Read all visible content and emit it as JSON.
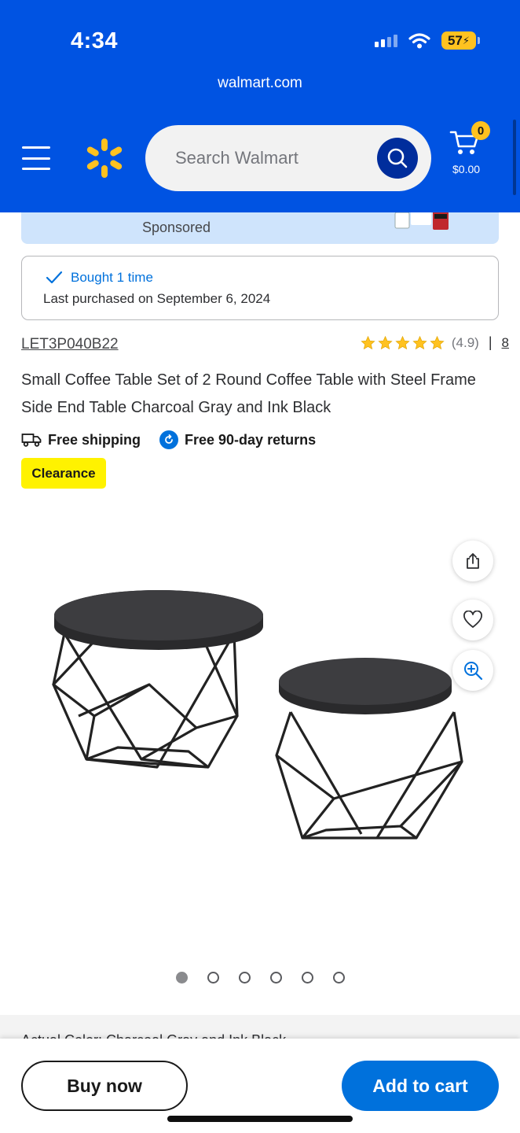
{
  "status_bar": {
    "time": "4:34",
    "battery": "57"
  },
  "browser": {
    "url": "walmart.com"
  },
  "header": {
    "search_placeholder": "Search Walmart",
    "cart_count": "0",
    "cart_total": "$0.00"
  },
  "banner": {
    "sponsored_label": "Sponsored"
  },
  "purchase_history": {
    "bought_label": "Bought 1 time",
    "last_purchased": "Last purchased on September 6, 2024"
  },
  "product": {
    "sku": "LET3P040B22",
    "rating": 4.9,
    "rating_text": "(4.9)",
    "review_count": "8",
    "title": "Small Coffee Table Set of 2 Round Coffee Table with Steel Frame Side End Table Charcoal Gray and Ink Black",
    "perks": [
      "Free shipping",
      "Free 90-day returns"
    ],
    "badge": "Clearance",
    "image_count": 6,
    "active_image_index": 0,
    "actual_color_peek": "Actual Color: Charcoal Gray and Ink Black"
  },
  "actions": {
    "buy_now": "Buy now",
    "add_to_cart": "Add to cart"
  },
  "colors": {
    "brand_blue": "#0053e2",
    "spark_yellow": "#ffc220",
    "action_blue": "#0071dc",
    "clearance_yellow": "#fff200"
  },
  "icons": [
    "menu-icon",
    "spark-logo-icon",
    "search-icon",
    "cart-icon",
    "check-icon",
    "star-icon",
    "truck-icon",
    "returns-icon",
    "share-icon",
    "heart-icon",
    "zoom-in-icon"
  ]
}
